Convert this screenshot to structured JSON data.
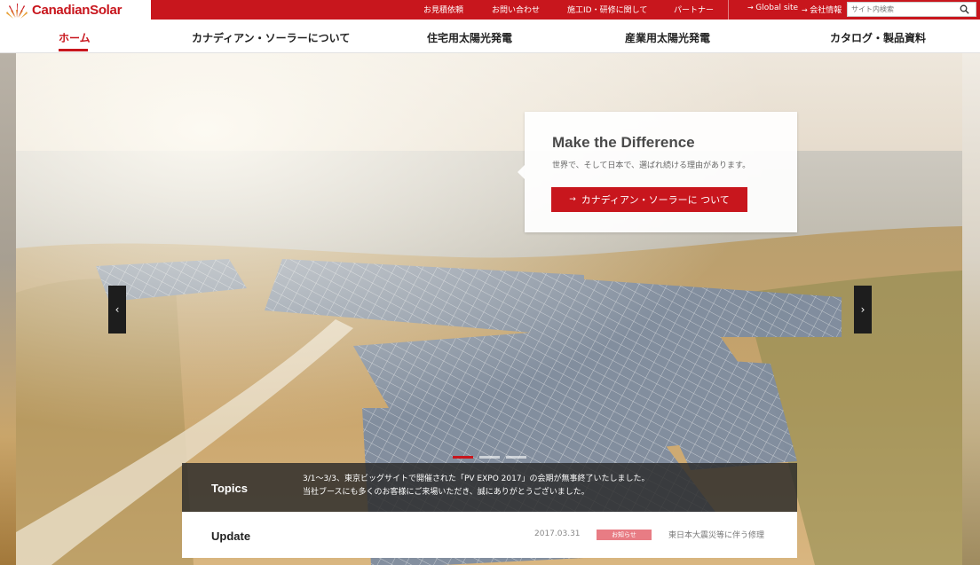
{
  "brand": {
    "logo_text": "CanadianSolar",
    "accent_color": "#c8161d"
  },
  "util_nav": {
    "links": [
      "お見積依頼",
      "お問い合わせ",
      "施工ID・研修に関して",
      "パートナー"
    ],
    "global_site": "Global site",
    "company_info": "会社情報",
    "search_placeholder": "サイト内検索"
  },
  "main_nav": {
    "items": [
      "ホーム",
      "カナディアン・ソーラーについて",
      "住宅用太陽光発電",
      "産業用太陽光発電",
      "カタログ・製品資料"
    ],
    "active_index": 0
  },
  "hero": {
    "title": "Make the Difference",
    "subtitle": "世界で、そして日本で、選ばれ続ける理由があります。",
    "button_label": "カナディアン・ソーラーに ついて",
    "prev_icon": "chevron-left-icon",
    "next_icon": "chevron-right-icon",
    "slide_count": 3,
    "active_slide": 1
  },
  "topics": {
    "label": "Topics",
    "line1": "3/1～3/3、東京ビッグサイトで開催された「PV EXPO 2017」の会期が無事終了いたしました。",
    "line2": "当社ブースにも多くのお客様にご来場いただき、誠にありがとうございました。"
  },
  "update": {
    "label": "Update",
    "date": "2017.03.31",
    "badge": "お知らせ",
    "text": "東日本大震災等に伴う修理"
  }
}
